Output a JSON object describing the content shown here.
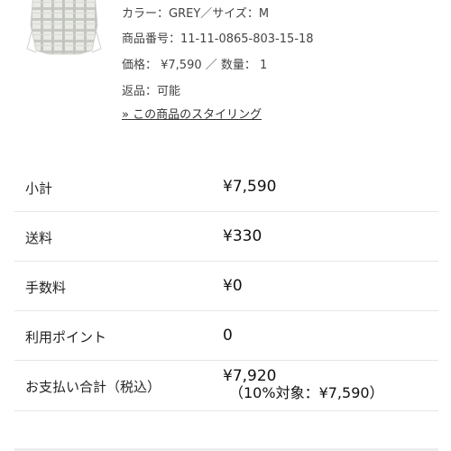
{
  "product": {
    "color_size": "カラー：GREY／サイズ：M",
    "product_number": "商品番号：11-11-0865-803-15-18",
    "price_quantity": "価格： ¥7,590 ／ 数量： 1",
    "returns": "返品：可能",
    "styling_link": "» この商品のスタイリング",
    "thumbnail_icon": "plaid-shirt-thumbnail"
  },
  "summary": {
    "rows": [
      {
        "label": "小計",
        "value": "¥7,590"
      },
      {
        "label": "送料",
        "value": "¥330"
      },
      {
        "label": "手数料",
        "value": "¥0"
      },
      {
        "label": "利用ポイント",
        "value": "0"
      },
      {
        "label": "お支払い合計（税込）",
        "value": "¥7,920",
        "sub": "（10%対象：¥7,590）"
      }
    ]
  }
}
